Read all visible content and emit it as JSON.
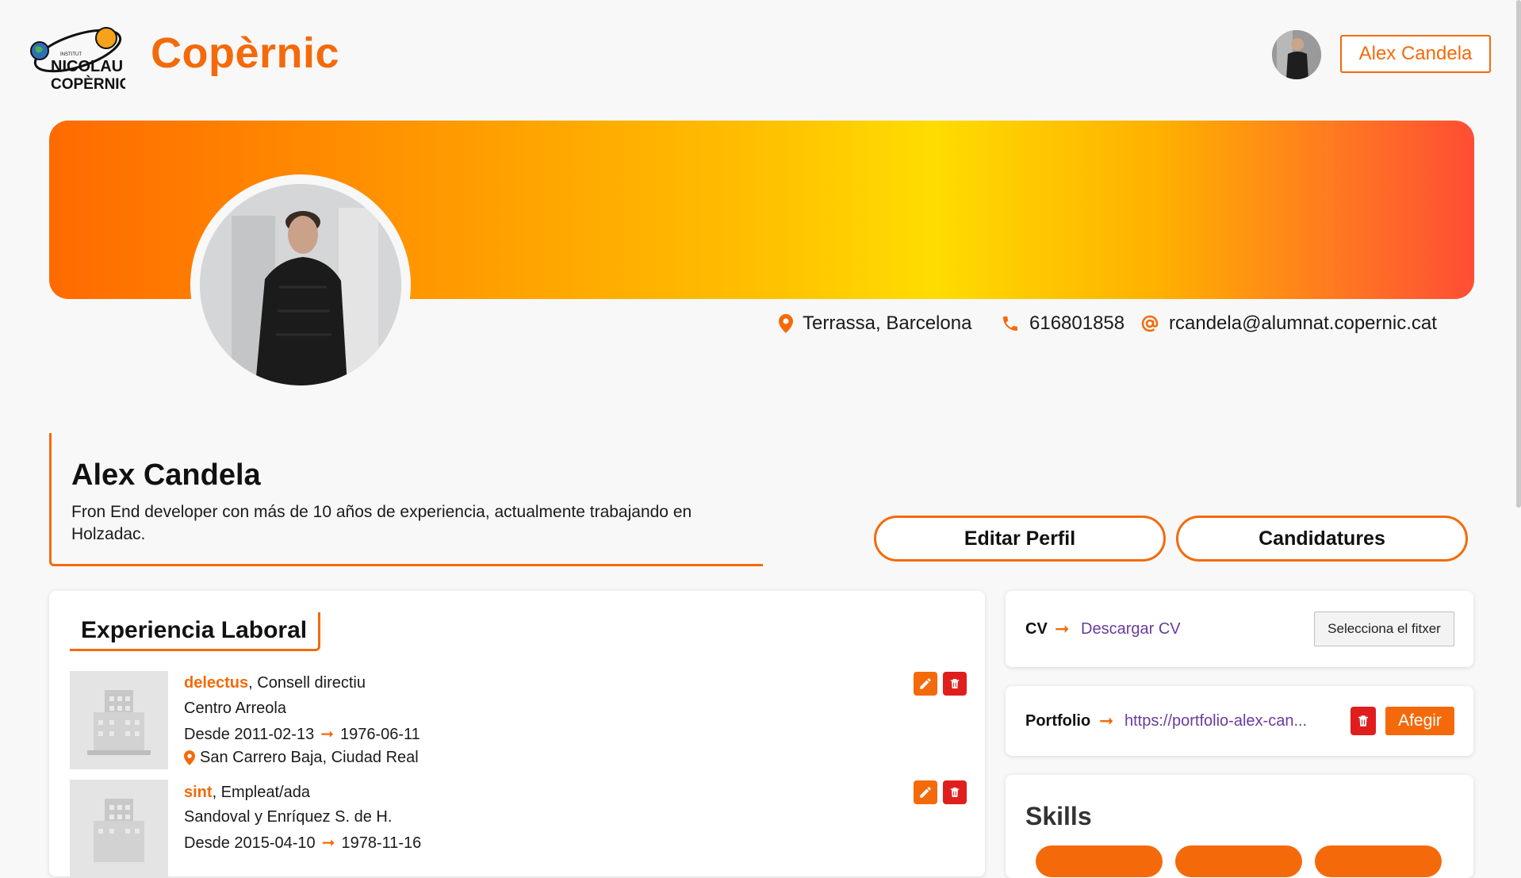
{
  "brand": {
    "name": "Copèrnic",
    "logo_alt": "Institut Nicolau Copèrnic"
  },
  "header": {
    "user_name": "Alex Candela"
  },
  "contact": {
    "location": "Terrassa, Barcelona",
    "phone": "616801858",
    "email": "rcandela@alumnat.copernic.cat"
  },
  "profile": {
    "name": "Alex Candela",
    "bio": "Fron End developer con más de 10 años de experiencia, actualmente trabajando en Holzadac."
  },
  "actions": {
    "edit_label": "Editar Perfil",
    "applications_label": "Candidatures"
  },
  "experience": {
    "title": "Experiencia Laboral",
    "items": [
      {
        "company": "delectus",
        "role": ", Consell directiu",
        "org": "Centro Arreola",
        "from_prefix": "Desde ",
        "from": "2011-02-13",
        "to": "1976-06-11",
        "location": "San Carrero Baja, Ciudad Real"
      },
      {
        "company": "sint",
        "role": ", Empleat/ada",
        "org": "Sandoval y Enríquez S. de H.",
        "from_prefix": "Desde ",
        "from": "2015-04-10",
        "to": "1978-11-16",
        "location": ""
      }
    ]
  },
  "cv": {
    "label": "CV",
    "link": "Descargar CV",
    "file_button": "Selecciona el fitxer"
  },
  "portfolio": {
    "label": "Portfolio",
    "link": "https://portfolio-alex-can...",
    "add_label": "Afegir"
  },
  "skills": {
    "title": "Skills"
  },
  "colors": {
    "accent": "#f46a0a",
    "danger": "#e01e1e",
    "link": "#6a3b9e"
  }
}
